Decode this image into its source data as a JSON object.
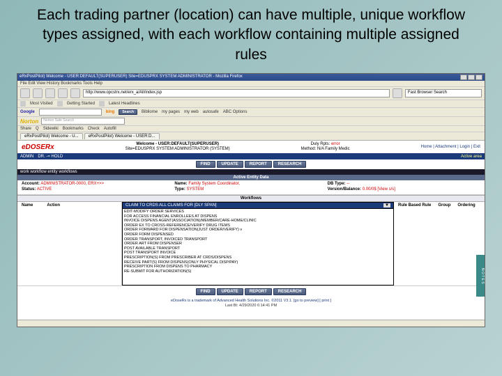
{
  "slide": {
    "title": "Each trading partner (location) can have multiple, unique workflow types assigned, with each workflow containing multiple assigned  rules"
  },
  "browser": {
    "title": "eRxPostPilot) Welcome - USER:DEFAULT(SUPERUSER) Site=EDUSPRX SYSTEM ADMINISTRATOR - Mozilla Firefox",
    "menu": "File  Edit  View  History  Bookmarks  Tools  Help",
    "url": "http://www.opcstrx.net/erx_a/All/index.jsp",
    "search_placeholder": "Fast Browser Search",
    "bookmarks": {
      "a": "Most Visited",
      "b": "Getting Started",
      "c": "Latest Headlines"
    },
    "google_row": {
      "logo": "Google",
      "bing": "bing",
      "search": "Search",
      "items": [
        "Bibliome",
        "my pages",
        "my web",
        "autosafe",
        "ABC Options"
      ]
    },
    "norton": {
      "logo": "Norton",
      "placeholder": "Norton Safe Search"
    },
    "extra_row": [
      "Share",
      "Q",
      "Sidewiki",
      "Bookmarks",
      "Check",
      "Autofill"
    ],
    "tabs": {
      "t1": "eRxPostPilot) Welcome - U...",
      "t2": "eRxPostPilot) Welcome - USER:D..."
    }
  },
  "app": {
    "logo": "eDOSERx",
    "welcome_line1": "Welcome - USER:DEFAULT(SUPERUSER)",
    "welcome_line2": "Site=EDUSPRX SYSTEM ADMINISTRATOR (SYSTEM)",
    "duly_label": "Duly Rpts: ",
    "duly_value": "error",
    "method_label": "Method:",
    "method_value": "N/A   Family Medic",
    "header_links": "Home | Attachment |  Login |  Exit",
    "nav": [
      "ADMIN",
      "DR.  -=  HOLD"
    ],
    "nav_right": "Active area",
    "btnrow1": [
      "FIND",
      "UPDATE",
      "REPORT",
      "RESEARCH"
    ],
    "dark_header": "work workflow entity workflows",
    "section_title": "Active Entity Data",
    "entity": {
      "account_label": "Account:",
      "account_value": "ADMINISTRATOR-0000, ERX+>>",
      "status_label": "Status:",
      "status_value": "ACTIVE",
      "name_label": "Name:",
      "name_value": "Family System Coordinator,",
      "type_label": "Type:",
      "type_value": "SYSTEM",
      "db_label": "DB Type:",
      "db_value": "--",
      "vb_label": "Version/Balance:",
      "vb_value": "0.00/0$   [View s/s]"
    },
    "workflows_title": "Workflows",
    "table_cols": {
      "name": "Name",
      "action": "Action",
      "rulebased": "Rule Based Rule",
      "group": "Group",
      "ordering": "Ordering"
    },
    "dropdown_selected": "CLAIM TO CRDS ALL CLAIMS FOR  [DLY SPAN]",
    "dropdown_items": [
      "EDIT-MODIFY ORDER SERVICES",
      "FOR ACCESS FINANCIAL ENROLLEES AT DISPENS",
      "INVOICE DISPENS  AGENT(ASSOCIATION)/MEMBER/CARE-HOME/CLINIC",
      "ORDER EX TO CROSS-REFERENCE/VERIFY DRUG ITEMS",
      "ORDER FORWARD FOR DISPENSATION(JUST ORDER/VERIFY) v",
      "ORDER FORM DISPENSED",
      "ORDER TRANSPORT, INVOICED TRANSPORT",
      "ORDER ART FROM DISPENSER",
      "POST AVAILABLE TRANSPORT",
      "POST TRANSPORT INVOICE",
      "PRESCRIPTION(S) FROM PRESCRIBER AT CRDS/DISPENS",
      "RECEIVE PART(S) FROM DISPENS(ONLY PHYSICAL DISP/PAY)",
      "PRESCRIPTION FROM DISPENS TO PHARMACY",
      "RE-SUBMIT FOR AUTHORIZATION(S)"
    ],
    "btnrow2": [
      "FIND",
      "UPDATE",
      "REPORT",
      "RESEARCH"
    ],
    "footer_line1": "eDoseRx is a trademark of Advanced Health Solutions Inc. ©2011 V3.1.  [go to preview]  [ print ]",
    "footer_line2": "Last Bt: 4/29/2020 6:14:41 PM",
    "side_tab": "N O T E S"
  }
}
